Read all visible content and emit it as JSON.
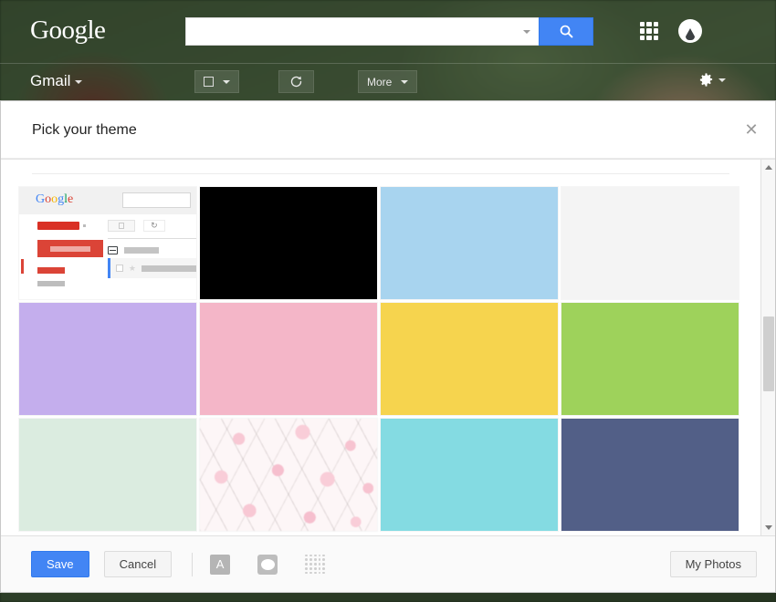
{
  "header": {
    "logo_text": "Google",
    "search": {
      "value": "",
      "placeholder": ""
    },
    "search_button_icon": "search-icon",
    "apps_icon": "apps-grid-icon",
    "avatar_icon": "account-avatar-icon"
  },
  "gmail_bar": {
    "app_label": "Gmail",
    "select_all_icon": "checkbox-icon",
    "refresh_icon": "refresh-icon",
    "more_label": "More",
    "settings_icon": "gear-icon"
  },
  "dialog": {
    "title": "Pick your theme",
    "close_icon": "close-icon"
  },
  "themes": [
    {
      "name": "Default",
      "type": "preview",
      "mini": {
        "logo": [
          {
            "ch": "G",
            "color": "#4285f4"
          },
          {
            "ch": "o",
            "color": "#db4437"
          },
          {
            "ch": "o",
            "color": "#f4b400"
          },
          {
            "ch": "g",
            "color": "#4285f4"
          },
          {
            "ch": "l",
            "color": "#0f9d58"
          },
          {
            "ch": "e",
            "color": "#db4437"
          }
        ]
      }
    },
    {
      "name": "Dark",
      "type": "solid",
      "color": "#000000"
    },
    {
      "name": "Light Blue",
      "type": "solid",
      "color": "#a8d4ef"
    },
    {
      "name": "White",
      "type": "solid",
      "color": "#f4f4f4"
    },
    {
      "name": "Lavender",
      "type": "solid",
      "color": "#c4aeed"
    },
    {
      "name": "Pink",
      "type": "solid",
      "color": "#f4b6c8"
    },
    {
      "name": "Yellow",
      "type": "solid",
      "color": "#f6d44e"
    },
    {
      "name": "Green",
      "type": "solid",
      "color": "#9ed25b"
    },
    {
      "name": "Mint",
      "type": "solid",
      "color": "#dbece0"
    },
    {
      "name": "Cherry Blossom",
      "type": "pattern",
      "color": "#fdf6f7"
    },
    {
      "name": "Turquoise",
      "type": "solid",
      "color": "#84dbe2"
    },
    {
      "name": "Slate Blue",
      "type": "solid",
      "color": "#525f87"
    }
  ],
  "footer": {
    "save_label": "Save",
    "cancel_label": "Cancel",
    "text_background_icon": "text-background-icon",
    "vignette_icon": "vignette-icon",
    "blur_icon": "blur-icon",
    "my_photos_label": "My Photos"
  },
  "scrollbar": {
    "up_icon": "scroll-up-arrow-icon",
    "down_icon": "scroll-down-arrow-icon"
  },
  "colors": {
    "accent_blue": "#4285f4",
    "gmail_red": "#db4437"
  }
}
